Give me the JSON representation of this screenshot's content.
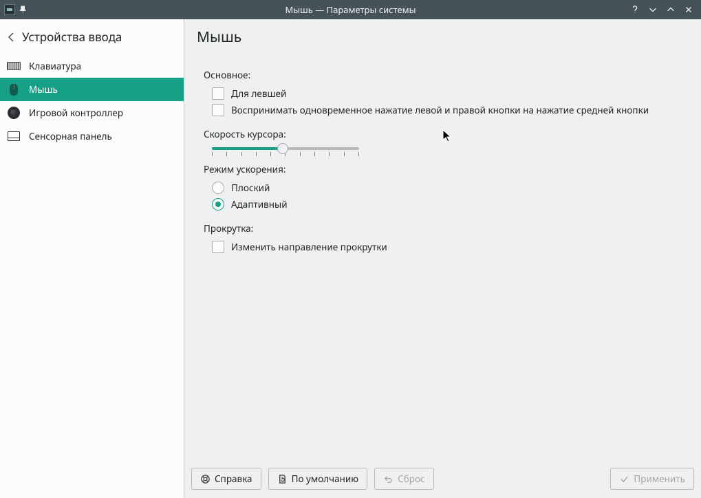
{
  "titlebar": {
    "title": "Мышь — Параметры системы"
  },
  "sidebar": {
    "header": "Устройства ввода",
    "items": [
      {
        "id": "keyboard",
        "label": "Клавиатура"
      },
      {
        "id": "mouse",
        "label": "Мышь"
      },
      {
        "id": "gamepad",
        "label": "Игровой контроллер"
      },
      {
        "id": "touchpad",
        "label": "Сенсорная панель"
      }
    ]
  },
  "main": {
    "heading": "Мышь",
    "general": {
      "label": "Основное:",
      "left_handed": "Для левшей",
      "chord_middle": "Воспринимать одновременное нажатие левой и правой кнопки на нажатие средней кнопки"
    },
    "speed": {
      "label": "Скорость курсора:",
      "value_percent": 48
    },
    "accel": {
      "label": "Режим ускорения:",
      "flat": "Плоский",
      "adaptive": "Адаптивный",
      "selected": "adaptive"
    },
    "scroll": {
      "label": "Прокрутка:",
      "reverse": "Изменить направление прокрутки"
    }
  },
  "footer": {
    "help": "Справка",
    "defaults": "По умолчанию",
    "reset": "Сброс",
    "apply": "Применить"
  }
}
